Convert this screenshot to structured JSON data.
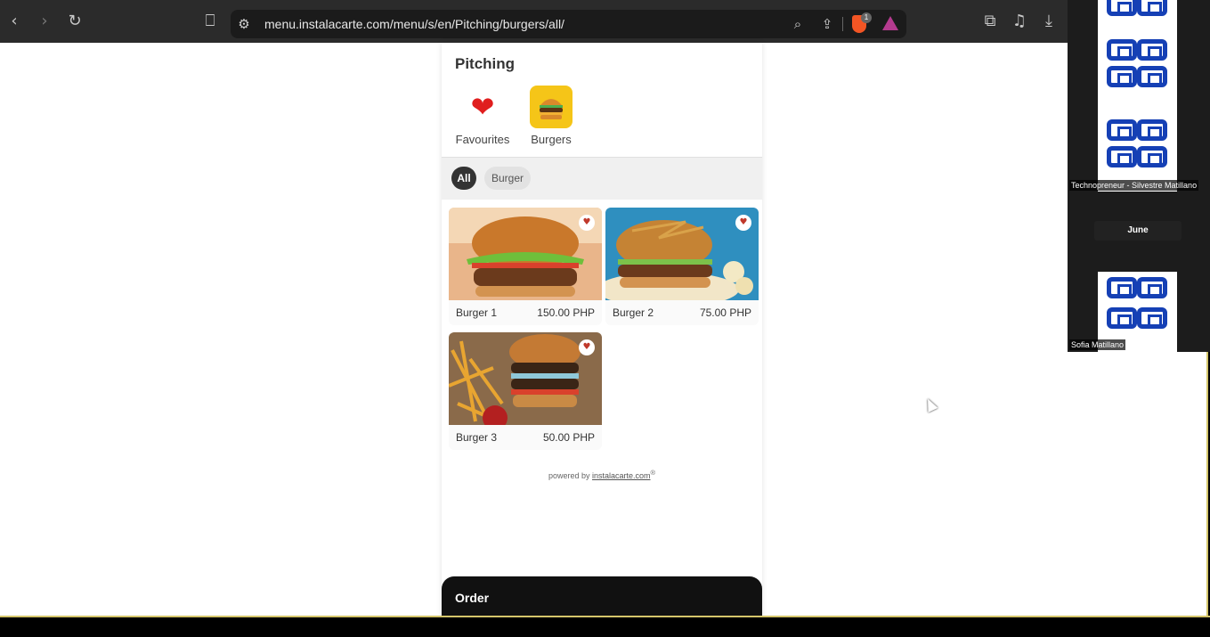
{
  "browser": {
    "url": "menu.instalacarte.com/menu/s/en/Pitching/burgers/all/",
    "brave_badge": "1",
    "icons": [
      "back-icon",
      "forward-icon",
      "reload-icon",
      "bookmark-icon",
      "site-settings-icon",
      "zoom-icon",
      "share-icon",
      "brave-shield-icon",
      "rewards-icon",
      "extensions-icon",
      "media-icon",
      "downloads-icon"
    ]
  },
  "menu": {
    "venue": "Pitching",
    "categories": [
      {
        "label": "Favourites",
        "icon": "heart-icon",
        "glyph": "❤"
      },
      {
        "label": "Burgers",
        "icon": "burger-icon",
        "glyph": "🍔"
      }
    ],
    "filters": [
      {
        "label": "All",
        "active": true
      },
      {
        "label": "Burger",
        "active": false
      }
    ],
    "items": [
      {
        "name": "Burger 1",
        "price": "150.00 PHP"
      },
      {
        "name": "Burger 2",
        "price": "75.00 PHP"
      },
      {
        "name": "Burger 3",
        "price": "50.00 PHP"
      }
    ],
    "powered_prefix": "powered by",
    "powered_link": "instalacarte.com",
    "powered_mark": "®",
    "order_label": "Order"
  },
  "meeting": {
    "participants": [
      {
        "label": "Technopreneur - Silvestre Matillano"
      },
      {
        "label": "June"
      },
      {
        "label": "Sofia Matillano"
      }
    ]
  },
  "colors": {
    "accent_yellow": "#f5c518",
    "qr_blue": "#1540b5",
    "order_bar": "#111111"
  }
}
